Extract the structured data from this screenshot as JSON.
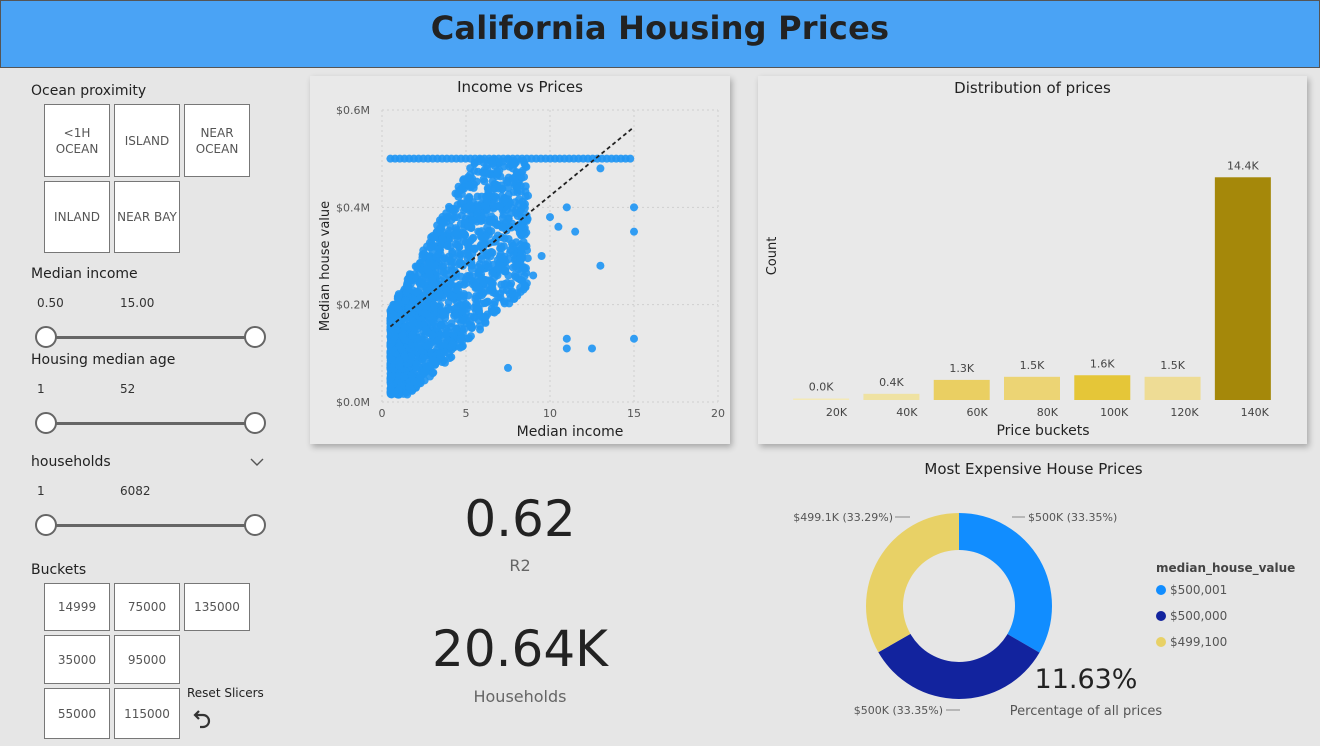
{
  "header": {
    "title": "California Housing Prices"
  },
  "filters": {
    "ocean": {
      "label": "Ocean proximity",
      "options": [
        "<1H OCEAN",
        "ISLAND",
        "NEAR OCEAN",
        "INLAND",
        "NEAR BAY"
      ]
    },
    "income": {
      "label": "Median income",
      "min": "0.50",
      "max": "15.00"
    },
    "age": {
      "label": "Housing median age",
      "min": "1",
      "max": "52"
    },
    "households": {
      "label": "households",
      "min": "1",
      "max": "6082"
    },
    "buckets": {
      "label": "Buckets",
      "options": [
        "14999",
        "75000",
        "135000",
        "35000",
        "95000",
        "55000",
        "115000"
      ]
    },
    "reset_label": "Reset Slicers"
  },
  "kpis": {
    "r2": {
      "value": "0.62",
      "label": "R2"
    },
    "households": {
      "value": "20.64K",
      "label": "Households"
    },
    "pct": {
      "value": "11.63%",
      "label": "Percentage of all prices"
    }
  },
  "icons": {
    "chevron": "chevron-down-icon",
    "reset": "undo-icon"
  },
  "colors": {
    "header": "#4aa3f5",
    "scatter": "#2196f3",
    "bar_light": "#efe0a0",
    "bar_mid": "#e8cd5a",
    "bar_dark": "#a5880a"
  },
  "chart_data": [
    {
      "type": "scatter",
      "title": "Income vs Prices",
      "xlabel": "Median income",
      "ylabel": "Median house value",
      "xlim": [
        0,
        20
      ],
      "ylim": [
        0,
        600000
      ],
      "x_ticks": [
        "0",
        "5",
        "10",
        "15",
        "20"
      ],
      "y_ticks": [
        "$0.0M",
        "$0.2M",
        "$0.4M",
        "$0.6M"
      ],
      "trendline": {
        "x": [
          0.5,
          15
        ],
        "y": [
          155000,
          565000
        ]
      },
      "points": [
        [
          15,
          400000
        ],
        [
          15,
          350000
        ],
        [
          15,
          130000
        ],
        [
          13,
          480000
        ],
        [
          13,
          280000
        ],
        [
          12.5,
          110000
        ],
        [
          11,
          400000
        ],
        [
          11,
          130000
        ],
        [
          11,
          110000
        ],
        [
          11.5,
          350000
        ],
        [
          10.5,
          360000
        ],
        [
          10,
          380000
        ],
        [
          9.5,
          300000
        ],
        [
          9,
          260000
        ],
        [
          8.5,
          240000
        ],
        [
          7.5,
          70000
        ]
      ],
      "grid": true
    },
    {
      "type": "bar",
      "title": "Distribution of prices",
      "xlabel": "Price buckets",
      "ylabel": "Count",
      "categories": [
        "20K",
        "40K",
        "60K",
        "80K",
        "100K",
        "120K",
        "140K"
      ],
      "values": [
        0,
        400,
        1300,
        1500,
        1600,
        1500,
        14400
      ],
      "data_labels": [
        "0.0K",
        "0.4K",
        "1.3K",
        "1.5K",
        "1.6K",
        "1.5K",
        "14.4K"
      ]
    },
    {
      "type": "pie",
      "title": "Most Expensive House Prices",
      "legend_title": "median_house_value",
      "slices": [
        {
          "name": "$500,001",
          "value": 33.35,
          "label": "$500K (33.35%)",
          "color": "#118dff"
        },
        {
          "name": "$500,000",
          "value": 33.35,
          "label": "$500K (33.35%)",
          "color": "#12239e"
        },
        {
          "name": "$499,100",
          "value": 33.29,
          "label": "$499.1K (33.29%)",
          "color": "#e8d166"
        }
      ]
    }
  ]
}
